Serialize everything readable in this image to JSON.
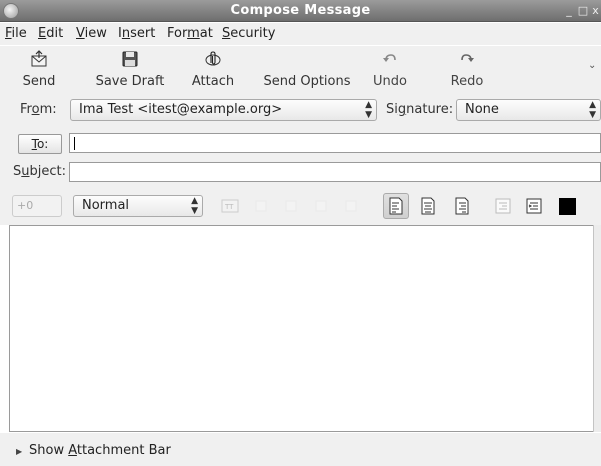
{
  "window": {
    "title": "Compose Message",
    "controls": {
      "minimize": "_",
      "maximize": "□",
      "close": "x"
    }
  },
  "menubar": {
    "items": [
      {
        "label": "File",
        "mnemonic": "F"
      },
      {
        "label": "Edit",
        "mnemonic": "E"
      },
      {
        "label": "View",
        "mnemonic": "V"
      },
      {
        "label": "Insert",
        "mnemonic": "n"
      },
      {
        "label": "Format",
        "mnemonic": "m"
      },
      {
        "label": "Security",
        "mnemonic": "S"
      }
    ]
  },
  "toolbar": {
    "send_label": "Send",
    "save_draft_label": "Save Draft",
    "attach_label": "Attach",
    "send_options_label": "Send Options",
    "undo_label": "Undo",
    "redo_label": "Redo",
    "overflow_icon": "chevron-down-icon"
  },
  "header": {
    "from_label": "From:",
    "from_value": "Ima Test <itest@example.org>",
    "signature_label": "Signature:",
    "signature_value": "None",
    "to_button_label": "To:",
    "to_value": "",
    "subject_label": "Subject:",
    "subject_value": ""
  },
  "format_bar": {
    "font_size": "+0",
    "paragraph_style": "Normal",
    "active_alignment": "left",
    "text_color": "#000000"
  },
  "body": {
    "content": ""
  },
  "footer": {
    "attachment_bar_label": "Show Attachment Bar"
  },
  "colors": {
    "titlebar": "#7f7f7f",
    "chrome": "#f0f0f0",
    "text": "#222222"
  }
}
